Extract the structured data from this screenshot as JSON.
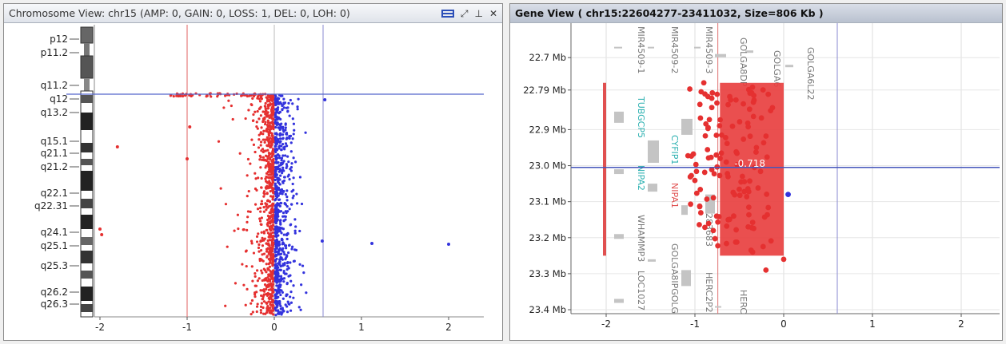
{
  "left": {
    "title": "Chromosome View: chr15 (AMP: 0, GAIN: 0, LOSS: 1, DEL: 0, LOH: 0)",
    "cytobands": [
      "p12",
      "p11.2",
      "q11.2",
      "q12",
      "q13.2",
      "q15.1",
      "q21.1",
      "q21.2",
      "q22.1",
      "q22.31",
      "q24.1",
      "q25.1",
      "q25.3",
      "q26.2",
      "q26.3"
    ],
    "x_ticks": [
      "-2",
      "-1",
      "0",
      "1",
      "2"
    ],
    "window_buttons": {
      "restore": "⤢",
      "pin": "⊥",
      "close": "✕"
    },
    "colors": {
      "loss": "#e53030",
      "gain": "#3333dd",
      "cursor": "#5566cc",
      "ref_red": "#e06060",
      "ref_blue": "#8a8ad0"
    }
  },
  "right": {
    "title": "Gene View ( chr15:22604277-23411032, Size=806 Kb )",
    "y_ticks": [
      "22.7 Mb",
      "22.79 Mb",
      "22.9 Mb",
      "23.0 Mb",
      "23.1 Mb",
      "23.2 Mb",
      "23.3 Mb",
      "23.4 Mb"
    ],
    "x_ticks": [
      "-2",
      "-1",
      "0",
      "1",
      "2"
    ],
    "cursor_value": "-0.718",
    "genes": [
      {
        "name": "MIR4509-1",
        "color": "#777777"
      },
      {
        "name": "MIR4509-2",
        "color": "#777777"
      },
      {
        "name": "MIR4509-3",
        "color": "#777777"
      },
      {
        "name": "GOLGA8DP",
        "color": "#777777"
      },
      {
        "name": "GOLGA6",
        "color": "#777777"
      },
      {
        "name": "GOLGA6L22",
        "color": "#777777"
      },
      {
        "name": "TUBGCP5",
        "color": "#2ab0b0"
      },
      {
        "name": "CYFIP1",
        "color": "#2ab0b0"
      },
      {
        "name": "NIPA2",
        "color": "#2ab0b0"
      },
      {
        "name": "NIPA1",
        "color": "#e05050"
      },
      {
        "name": "283683",
        "color": "#777777"
      },
      {
        "name": "WHAMMP3",
        "color": "#777777"
      },
      {
        "name": "LOC1027",
        "color": "#777777"
      },
      {
        "name": "GOLGA8IPGOLG",
        "color": "#777777"
      },
      {
        "name": "HERC2P2",
        "color": "#777777"
      },
      {
        "name": "HERC",
        "color": "#777777"
      }
    ],
    "segment": {
      "start_mb": 22.77,
      "end_mb": 23.25,
      "value": -0.718,
      "color": "#e84040"
    },
    "colors": {
      "points": "#e53030",
      "gain_point": "#3333dd",
      "cursor": "#4455bb"
    }
  }
}
